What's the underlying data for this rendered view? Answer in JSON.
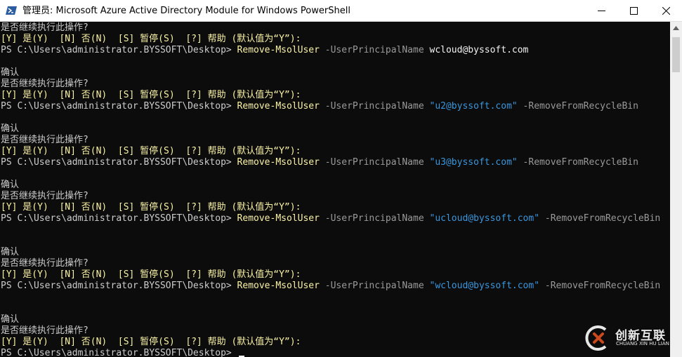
{
  "window": {
    "title": "管理员: Microsoft Azure Active Directory Module for Windows PowerShell",
    "controls": [
      "minimize",
      "maximize",
      "close"
    ]
  },
  "console": {
    "lines": [
      {
        "segments": [
          {
            "text": "是否继续执行此操作?",
            "color": "default"
          }
        ]
      },
      {
        "segments": [
          {
            "text": "[Y] 是(Y)  [N] 否(N)  [S] 暂停(S)  [?] 帮助 (默认值为“Y”):",
            "color": "yellow"
          }
        ]
      },
      {
        "segments": [
          {
            "text": "PS C:\\Users\\administrator.BYSSOFT\\Desktop> ",
            "color": "default"
          },
          {
            "text": "Remove-MsolUser",
            "color": "yellow"
          },
          {
            "text": " -UserPrincipalName ",
            "color": "gray"
          },
          {
            "text": "wcloud@byssoft.com",
            "color": "white"
          }
        ]
      },
      {
        "segments": []
      },
      {
        "segments": [
          {
            "text": "确认",
            "color": "default"
          }
        ]
      },
      {
        "segments": [
          {
            "text": "是否继续执行此操作?",
            "color": "default"
          }
        ]
      },
      {
        "segments": [
          {
            "text": "[Y] 是(Y)  [N] 否(N)  [S] 暂停(S)  [?] 帮助 (默认值为“Y”):",
            "color": "yellow"
          }
        ]
      },
      {
        "segments": [
          {
            "text": "PS C:\\Users\\administrator.BYSSOFT\\Desktop> ",
            "color": "default"
          },
          {
            "text": "Remove-MsolUser",
            "color": "yellow"
          },
          {
            "text": " -UserPrincipalName ",
            "color": "gray"
          },
          {
            "text": "\"u2@byssoft.com\"",
            "color": "cyan"
          },
          {
            "text": " -RemoveFromRecycleBin",
            "color": "gray"
          }
        ]
      },
      {
        "segments": []
      },
      {
        "segments": [
          {
            "text": "确认",
            "color": "default"
          }
        ]
      },
      {
        "segments": [
          {
            "text": "是否继续执行此操作?",
            "color": "default"
          }
        ]
      },
      {
        "segments": [
          {
            "text": "[Y] 是(Y)  [N] 否(N)  [S] 暂停(S)  [?] 帮助 (默认值为“Y”):",
            "color": "yellow"
          }
        ]
      },
      {
        "segments": [
          {
            "text": "PS C:\\Users\\administrator.BYSSOFT\\Desktop> ",
            "color": "default"
          },
          {
            "text": "Remove-MsolUser",
            "color": "yellow"
          },
          {
            "text": " -UserPrincipalName ",
            "color": "gray"
          },
          {
            "text": "\"u3@byssoft.com\"",
            "color": "cyan"
          },
          {
            "text": " -RemoveFromRecycleBin",
            "color": "gray"
          }
        ]
      },
      {
        "segments": []
      },
      {
        "segments": [
          {
            "text": "确认",
            "color": "default"
          }
        ]
      },
      {
        "segments": [
          {
            "text": "是否继续执行此操作?",
            "color": "default"
          }
        ]
      },
      {
        "segments": [
          {
            "text": "[Y] 是(Y)  [N] 否(N)  [S] 暂停(S)  [?] 帮助 (默认值为“Y”):",
            "color": "yellow"
          }
        ]
      },
      {
        "segments": [
          {
            "text": "PS C:\\Users\\administrator.BYSSOFT\\Desktop> ",
            "color": "default"
          },
          {
            "text": "Remove-MsolUser",
            "color": "yellow"
          },
          {
            "text": " -UserPrincipalName ",
            "color": "gray"
          },
          {
            "text": "\"ucloud@byssoft.com\"",
            "color": "cyan"
          },
          {
            "text": " -RemoveFromRecycleBin",
            "color": "gray"
          }
        ]
      },
      {
        "segments": []
      },
      {
        "segments": []
      },
      {
        "segments": [
          {
            "text": "确认",
            "color": "default"
          }
        ]
      },
      {
        "segments": [
          {
            "text": "是否继续执行此操作?",
            "color": "default"
          }
        ]
      },
      {
        "segments": [
          {
            "text": "[Y] 是(Y)  [N] 否(N)  [S] 暂停(S)  [?] 帮助 (默认值为“Y”):",
            "color": "yellow"
          }
        ]
      },
      {
        "segments": [
          {
            "text": "PS C:\\Users\\administrator.BYSSOFT\\Desktop> ",
            "color": "default"
          },
          {
            "text": "Remove-MsolUser",
            "color": "yellow"
          },
          {
            "text": " -UserPrincipalName ",
            "color": "gray"
          },
          {
            "text": "\"wcloud@byssoft.com\"",
            "color": "cyan"
          },
          {
            "text": " -RemoveFromRecycleBin",
            "color": "gray"
          }
        ]
      },
      {
        "segments": []
      },
      {
        "segments": []
      },
      {
        "segments": [
          {
            "text": "确认",
            "color": "default"
          }
        ]
      },
      {
        "segments": [
          {
            "text": "是否继续执行此操作?",
            "color": "default"
          }
        ]
      },
      {
        "segments": [
          {
            "text": "[Y] 是(Y)  [N] 否(N)  [S] 暂停(S)  [?] 帮助 (默认值为“Y”):",
            "color": "yellow"
          }
        ]
      },
      {
        "segments": [
          {
            "text": "PS C:\\Users\\administrator.BYSSOFT\\Desktop> ",
            "color": "default"
          }
        ],
        "cursor": true
      }
    ]
  },
  "colors": {
    "console_background": "#0c0c0c",
    "default_text": "#cccccc",
    "yellow": "#f9f1a5",
    "gray": "#9a9a9a",
    "cyan": "#3a96dd",
    "white": "#f2f2f2"
  },
  "watermark": {
    "name": "创新互联",
    "subtitle": "CHUANG XIN HU LIAN"
  },
  "icons": {
    "app": "powershell-icon",
    "minimize": "minimize-icon",
    "maximize": "maximize-icon",
    "close": "close-icon",
    "scroll_up": "chevron-up-icon",
    "watermark_logo": "chuangxin-logo-icon"
  }
}
